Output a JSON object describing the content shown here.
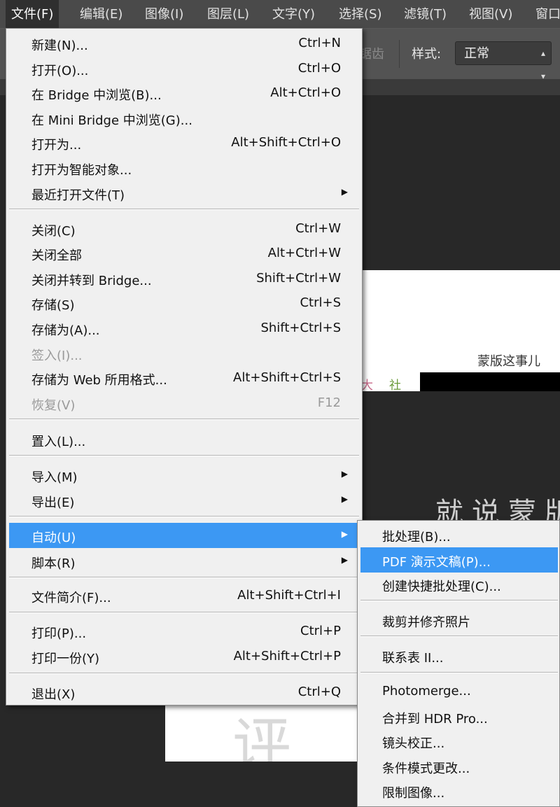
{
  "menubar": {
    "items": [
      {
        "label": "文件(F)",
        "active": true
      },
      {
        "label": "编辑(E)"
      },
      {
        "label": "图像(I)"
      },
      {
        "label": "图层(L)"
      },
      {
        "label": "文字(Y)"
      },
      {
        "label": "选择(S)"
      },
      {
        "label": "滤镜(T)"
      },
      {
        "label": "视图(V)"
      },
      {
        "label": "窗口"
      }
    ]
  },
  "options_bar": {
    "partial_label": "锯齿",
    "style_label": "样式:",
    "style_value": "正常"
  },
  "canvas": {
    "caption": "蒙版这事儿",
    "char1": "大",
    "char2": "社",
    "big_text": "就说蒙版",
    "faint_text": "评"
  },
  "file_menu": {
    "items": [
      {
        "label": "新建(N)...",
        "shortcut": "Ctrl+N"
      },
      {
        "label": "打开(O)...",
        "shortcut": "Ctrl+O"
      },
      {
        "label": "在 Bridge 中浏览(B)...",
        "shortcut": "Alt+Ctrl+O"
      },
      {
        "label": "在 Mini Bridge 中浏览(G)...",
        "shortcut": ""
      },
      {
        "label": "打开为...",
        "shortcut": "Alt+Shift+Ctrl+O"
      },
      {
        "label": "打开为智能对象...",
        "shortcut": ""
      },
      {
        "label": "最近打开文件(T)",
        "shortcut": ""
      },
      {
        "label": "关闭(C)",
        "shortcut": "Ctrl+W"
      },
      {
        "label": "关闭全部",
        "shortcut": "Alt+Ctrl+W"
      },
      {
        "label": "关闭并转到 Bridge...",
        "shortcut": "Shift+Ctrl+W"
      },
      {
        "label": "存储(S)",
        "shortcut": "Ctrl+S"
      },
      {
        "label": "存储为(A)...",
        "shortcut": "Shift+Ctrl+S"
      },
      {
        "label": "签入(I)...",
        "shortcut": ""
      },
      {
        "label": "存储为 Web 所用格式...",
        "shortcut": "Alt+Shift+Ctrl+S"
      },
      {
        "label": "恢复(V)",
        "shortcut": "F12"
      },
      {
        "label": "置入(L)...",
        "shortcut": ""
      },
      {
        "label": "导入(M)",
        "shortcut": ""
      },
      {
        "label": "导出(E)",
        "shortcut": ""
      },
      {
        "label": "自动(U)",
        "shortcut": ""
      },
      {
        "label": "脚本(R)",
        "shortcut": ""
      },
      {
        "label": "文件简介(F)...",
        "shortcut": "Alt+Shift+Ctrl+I"
      },
      {
        "label": "打印(P)...",
        "shortcut": "Ctrl+P"
      },
      {
        "label": "打印一份(Y)",
        "shortcut": "Alt+Shift+Ctrl+P"
      },
      {
        "label": "退出(X)",
        "shortcut": "Ctrl+Q"
      }
    ],
    "submenu_arrow": "▶"
  },
  "automate_submenu": {
    "items": [
      {
        "label": "批处理(B)..."
      },
      {
        "label": "PDF 演示文稿(P)..."
      },
      {
        "label": "创建快捷批处理(C)..."
      },
      {
        "label": "裁剪并修齐照片"
      },
      {
        "label": "联系表 II..."
      },
      {
        "label": "Photomerge..."
      },
      {
        "label": "合并到 HDR Pro..."
      },
      {
        "label": "镜头校正..."
      },
      {
        "label": "条件模式更改..."
      },
      {
        "label": "限制图像..."
      }
    ]
  }
}
